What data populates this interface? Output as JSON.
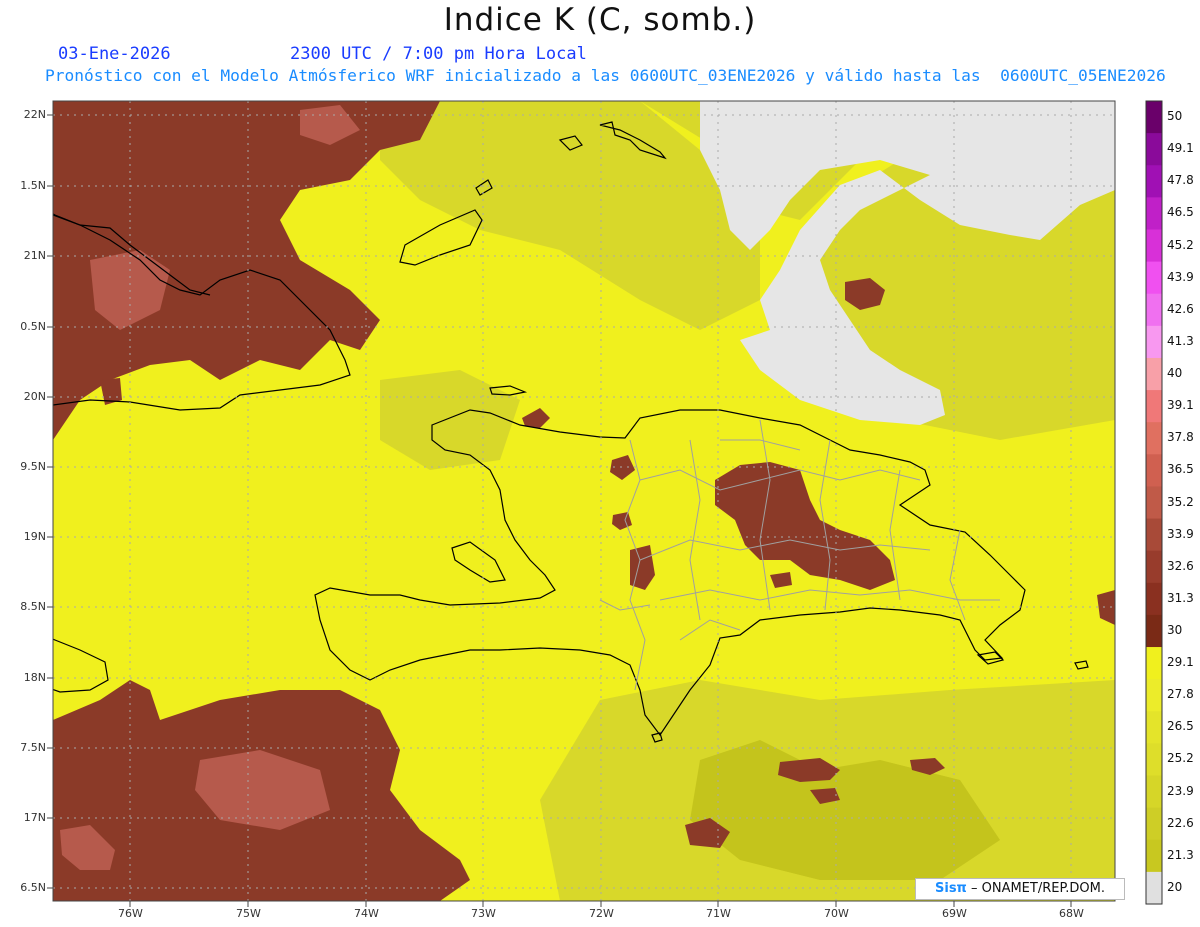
{
  "header": {
    "title": "Indice K (C, somb.)",
    "date": "03-Ene-2026",
    "time": "2300 UTC / 7:00 pm Hora Local",
    "forecast_line": "Pronóstico con el Modelo Atmósferico WRF inicializado a las 0600UTC_03ENE2026 y válido hasta las  0600UTC_05ENE2026"
  },
  "map": {
    "lat_labels": [
      "22N",
      "1.5N",
      "21N",
      "0.5N",
      "20N",
      "9.5N",
      "19N",
      "8.5N",
      "18N",
      "7.5N",
      "17N",
      "6.5N"
    ],
    "lon_labels": [
      "76W",
      "75W",
      "74W",
      "73W",
      "72W",
      "71W",
      "70W",
      "69W",
      "68W"
    ],
    "colors": {
      "yellow": "#f0f01e",
      "olive": "#d8d82a",
      "dark_olive": "#c4c41c",
      "brown": "#8b3a28",
      "light_brown": "#b65a4c",
      "missing": "#e6e6e6",
      "coast": "#000000",
      "province_border": "#a0a0a0"
    }
  },
  "colorbar": {
    "labels": [
      "50",
      "49.1",
      "47.8",
      "46.5",
      "45.2",
      "43.9",
      "42.6",
      "41.3",
      "40",
      "39.1",
      "37.8",
      "36.5",
      "35.2",
      "33.9",
      "32.6",
      "31.3",
      "30",
      "29.1",
      "27.8",
      "26.5",
      "25.2",
      "23.9",
      "22.6",
      "21.3",
      "20"
    ],
    "colors": [
      "#6a006a",
      "#8a0a9a",
      "#a010b4",
      "#c020c8",
      "#d830d8",
      "#f050f0",
      "#f070f0",
      "#f898f0",
      "#f8a0a8",
      "#f07878",
      "#e07060",
      "#d06050",
      "#c05a48",
      "#a84a38",
      "#983c2c",
      "#8a3020",
      "#7a2a16",
      "#f0f01e",
      "#ecec2a",
      "#e4e42a",
      "#dede2a",
      "#d6d628",
      "#cece26",
      "#c8c820",
      "#e0e0e0"
    ]
  },
  "credit": {
    "brand": "Sisπ",
    "text": " – ONAMET/REP.DOM."
  }
}
